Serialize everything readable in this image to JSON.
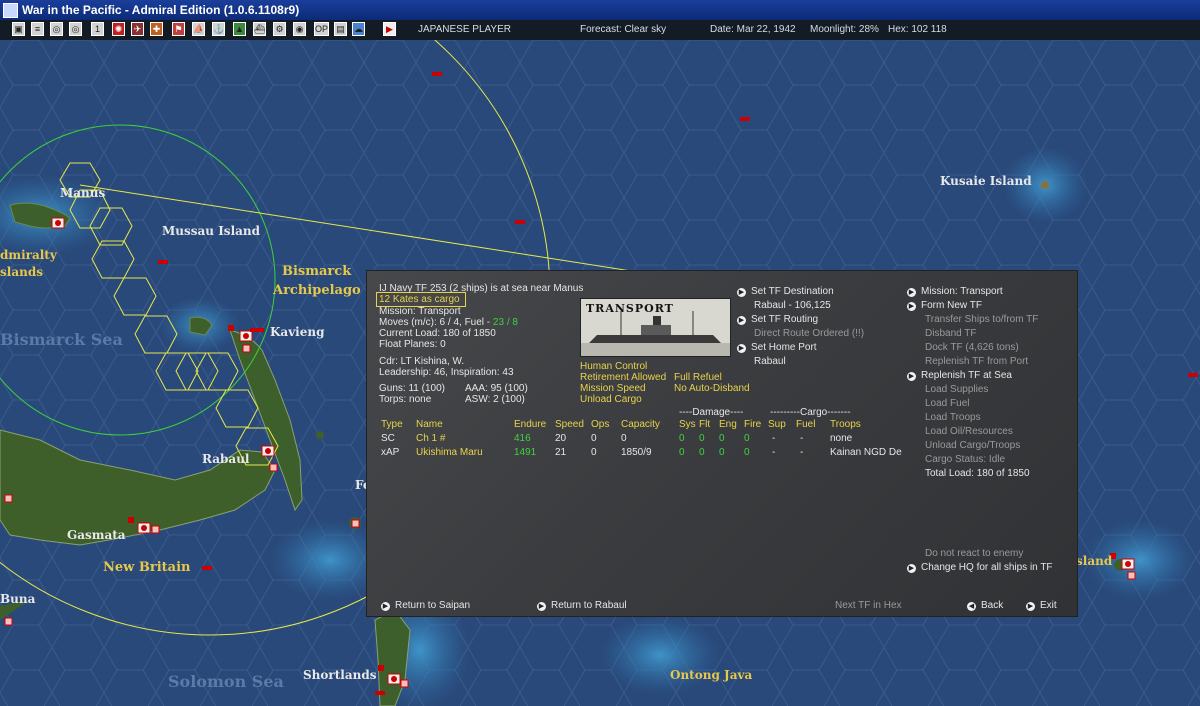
{
  "window": {
    "title": "War in the Pacific - Admiral Edition (1.0.6.1108r9)"
  },
  "toolbar": {
    "player": "JAPANESE PLAYER",
    "forecast": "Forecast: Clear sky",
    "date": "Date: Mar 22, 1942",
    "moonlight": "Moonlight: 28%",
    "hex": "Hex: 102 118"
  },
  "map_labels": {
    "manus": "Manus",
    "mussau": "Mussau Island",
    "admiralty1": "dmiralty",
    "admiralty2": "slands",
    "bismarck1": "Bismarck",
    "bismarck2": "Archipelago",
    "bismarck_sea": "Bismarck Sea",
    "kavieng": "Kavieng",
    "rabaul": "Rabaul",
    "gasmata": "Gasmata",
    "new_britain": "New Britain",
    "buna": "Buna",
    "shortlands": "Shortlands",
    "solomon_sea": "Solomon Sea",
    "ontong_java": "Ontong Java",
    "kusaie": "Kusaie Island",
    "fe": "Fe",
    "island_right": "sland"
  },
  "tf": {
    "header": "IJ Navy TF 253 (2 ships) is at sea near Manus",
    "cargo": "12 Kates as cargo",
    "mission": "Mission: Transport",
    "moves": "Moves (m/c): 6 / 4, Fuel - ",
    "fuel": "23 / 8",
    "load": "Current Load: 180 of 1850",
    "float": "Float Planes: 0",
    "cdr": "Cdr: LT Kishina, W.",
    "leadership": "Leadership: 46, Inspiration: 43",
    "guns": "Guns: 11 (100)",
    "aaa": "AAA: 95 (100)",
    "torps": "Torps: none",
    "asw": "ASW: 2 (100)",
    "photo_label": "TRANSPORT",
    "human_control": "Human Control",
    "retirement": "Retirement Allowed",
    "full_refuel": "Full Refuel",
    "mission_speed": "Mission Speed",
    "no_auto": "No Auto-Disband",
    "unload": "Unload Cargo",
    "set_dest": "Set TF Destination",
    "dest_value": "Rabaul - 106,125",
    "set_routing": "Set TF Routing",
    "routing_value": "Direct Route Ordered (!!)",
    "set_home": "Set Home Port",
    "home_value": "Rabaul"
  },
  "table": {
    "damage_hdr": "----Damage----",
    "cargo_hdr": "---------Cargo-------",
    "cols": [
      "Type",
      "Name",
      "Endure",
      "Speed",
      "Ops",
      "Capacity",
      "Sys",
      "Flt",
      "Eng",
      "Fire",
      "Sup",
      "Fuel",
      "Troops"
    ],
    "rows": [
      [
        "SC",
        "Ch 1 #",
        "416",
        "20",
        "0",
        "0",
        "0",
        "0",
        "0",
        "0",
        "-",
        "-",
        "none"
      ],
      [
        "xAP",
        "Ukishima Maru",
        "1491",
        "21",
        "0",
        "1850/9",
        "0",
        "0",
        "0",
        "0",
        "-",
        "-",
        "Kainan NGD De"
      ]
    ]
  },
  "right_menu": {
    "mission": "Mission: Transport",
    "form": "Form New TF",
    "transfer": "Transfer Ships to/from TF",
    "disband": "Disband TF",
    "dock": "Dock TF (4,626 tons)",
    "replenish_port": "Replenish TF from Port",
    "replenish_sea": "Replenish TF at Sea",
    "load_supplies": "Load Supplies",
    "load_fuel": "Load Fuel",
    "load_troops": "Load Troops",
    "load_oil": "Load Oil/Resources",
    "unload_cargo": "Unload Cargo/Troops",
    "cargo_status": "Cargo Status: Idle",
    "total_load": "Total Load: 180 of 1850",
    "no_react": "Do not react to enemy",
    "change_hq": "Change HQ for all ships in TF"
  },
  "footer": {
    "return_saipan": "Return to Saipan",
    "return_rabaul": "Return to Rabaul",
    "next_tf": "Next TF in Hex",
    "back": "Back",
    "exit": "Exit"
  },
  "colors": {
    "text_yellow": "#e8d34a",
    "text_green": "#3fd23f",
    "ocean": "#2a4a7c",
    "land": "#3c5a2a"
  }
}
